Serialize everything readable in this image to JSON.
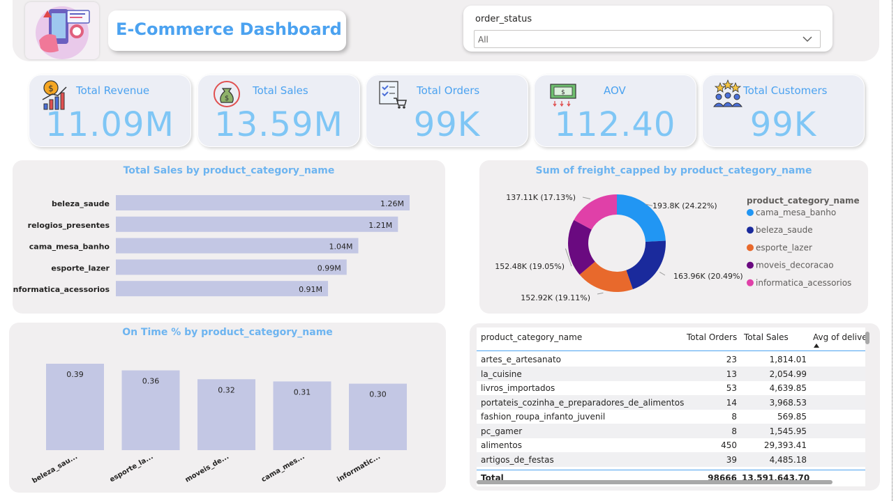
{
  "header": {
    "title": "E-Commerce Dashboard",
    "filter": {
      "label": "order_status",
      "value": "All"
    }
  },
  "kpis": [
    {
      "label": "Total Revenue",
      "value": "11.09M",
      "icon": "revenue-chart-icon"
    },
    {
      "label": "Total Sales",
      "value": "13.59M",
      "icon": "money-bag-icon"
    },
    {
      "label": "Total Orders",
      "value": "99K",
      "icon": "order-checklist-icon"
    },
    {
      "label": "AOV",
      "value": "112.40",
      "icon": "cash-icon"
    },
    {
      "label": "Total Customers",
      "value": "99K",
      "icon": "customers-icon"
    }
  ],
  "colors": {
    "accent": "#4ba2f0",
    "bar": "#c3c7e4",
    "panel": "#f1eff0",
    "donut": [
      "#2196f3",
      "#1a2a9c",
      "#e8692c",
      "#6a0a80",
      "#e040a8"
    ]
  },
  "chart_data": [
    {
      "type": "bar",
      "orientation": "horizontal",
      "title": "Total Sales by product_category_name",
      "categories": [
        "beleza_saude",
        "relogios_presentes",
        "cama_mesa_banho",
        "esporte_lazer",
        "informatica_acessorios"
      ],
      "values": [
        1.26,
        1.21,
        1.04,
        0.99,
        0.91
      ],
      "data_labels": [
        "1.26M",
        "1.21M",
        "1.04M",
        "0.99M",
        "0.91M"
      ],
      "unit": "M"
    },
    {
      "type": "pie",
      "donut": true,
      "title": "Sum of freight_capped by product_category_name",
      "legend_title": "product_category_name",
      "legend_position": "right",
      "categories": [
        "cama_mesa_banho",
        "beleza_saude",
        "esporte_lazer",
        "moveis_decoracao",
        "informatica_acessorios"
      ],
      "values": [
        193.8,
        163.96,
        152.92,
        152.48,
        137.11
      ],
      "percents": [
        24.22,
        20.49,
        19.11,
        19.05,
        17.13
      ],
      "data_labels": [
        "193.8K (24.22%)",
        "163.96K (20.49%)",
        "152.92K (19.11%)",
        "152.48K (19.05%)",
        "137.11K (17.13%)"
      ]
    },
    {
      "type": "bar",
      "orientation": "vertical",
      "title": "On Time % by product_category_name",
      "categories": [
        "beleza_sau...",
        "esporte_la...",
        "moveis_de...",
        "cama_mes...",
        "informatic..."
      ],
      "values": [
        0.39,
        0.36,
        0.32,
        0.31,
        0.3
      ],
      "data_labels": [
        "0.39",
        "0.36",
        "0.32",
        "0.31",
        "0.30"
      ]
    },
    {
      "type": "table",
      "columns": [
        "product_category_name",
        "Total Orders",
        "Total Sales",
        "Avg of delive"
      ],
      "sorted_column": "Avg of delive",
      "rows": [
        [
          "artes_e_artesanato",
          "23",
          "1,814.01",
          ""
        ],
        [
          "la_cuisine",
          "13",
          "2,054.99",
          ""
        ],
        [
          "livros_importados",
          "53",
          "4,639.85",
          ""
        ],
        [
          "portateis_cozinha_e_preparadores_de_alimentos",
          "14",
          "3,968.53",
          ""
        ],
        [
          "fashion_roupa_infanto_juvenil",
          "8",
          "569.85",
          ""
        ],
        [
          "pc_gamer",
          "8",
          "1,545.95",
          ""
        ],
        [
          "alimentos",
          "450",
          "29,393.41",
          ""
        ],
        [
          "artigos_de_festas",
          "39",
          "4,485.18",
          ""
        ]
      ],
      "total": [
        "Total",
        "98666",
        "13,591,643.70",
        ""
      ]
    }
  ]
}
